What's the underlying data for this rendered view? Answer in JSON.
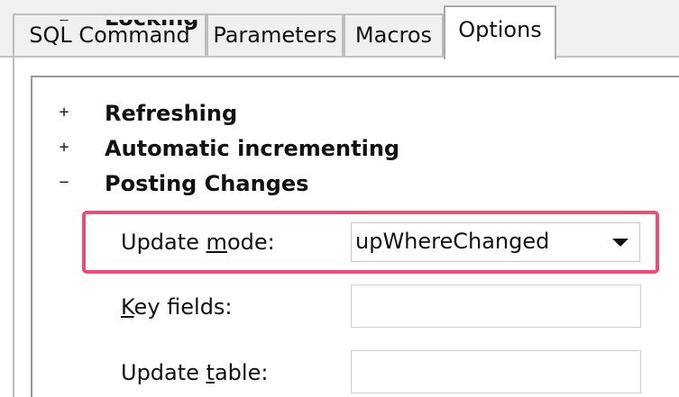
{
  "tabs": [
    {
      "label": "SQL Command",
      "active": false
    },
    {
      "label": "Parameters",
      "active": false
    },
    {
      "label": "Macros",
      "active": false
    },
    {
      "label": "Options",
      "active": true
    }
  ],
  "tree": {
    "items": [
      {
        "label": "Locking",
        "expander": "−",
        "state": "expanded",
        "clipped": true
      },
      {
        "label": "Refreshing",
        "expander": "+",
        "state": "collapsed"
      },
      {
        "label": "Automatic incrementing",
        "expander": "+",
        "state": "collapsed"
      },
      {
        "label": "Posting Changes",
        "expander": "−",
        "state": "expanded"
      }
    ]
  },
  "posting_changes": {
    "update_mode": {
      "label_pre": "Update ",
      "label_mnemonic": "m",
      "label_post": "ode:",
      "value": "upWhereChanged"
    },
    "key_fields": {
      "label_pre": "",
      "label_mnemonic": "K",
      "label_post": "ey fields:",
      "value": ""
    },
    "update_table": {
      "label_pre": "Update ",
      "label_mnemonic": "t",
      "label_post": "able:",
      "value": ""
    }
  },
  "colors": {
    "highlight": "#e8507a",
    "panel_background": "#ffffff",
    "window_background": "#f0f0f0"
  }
}
